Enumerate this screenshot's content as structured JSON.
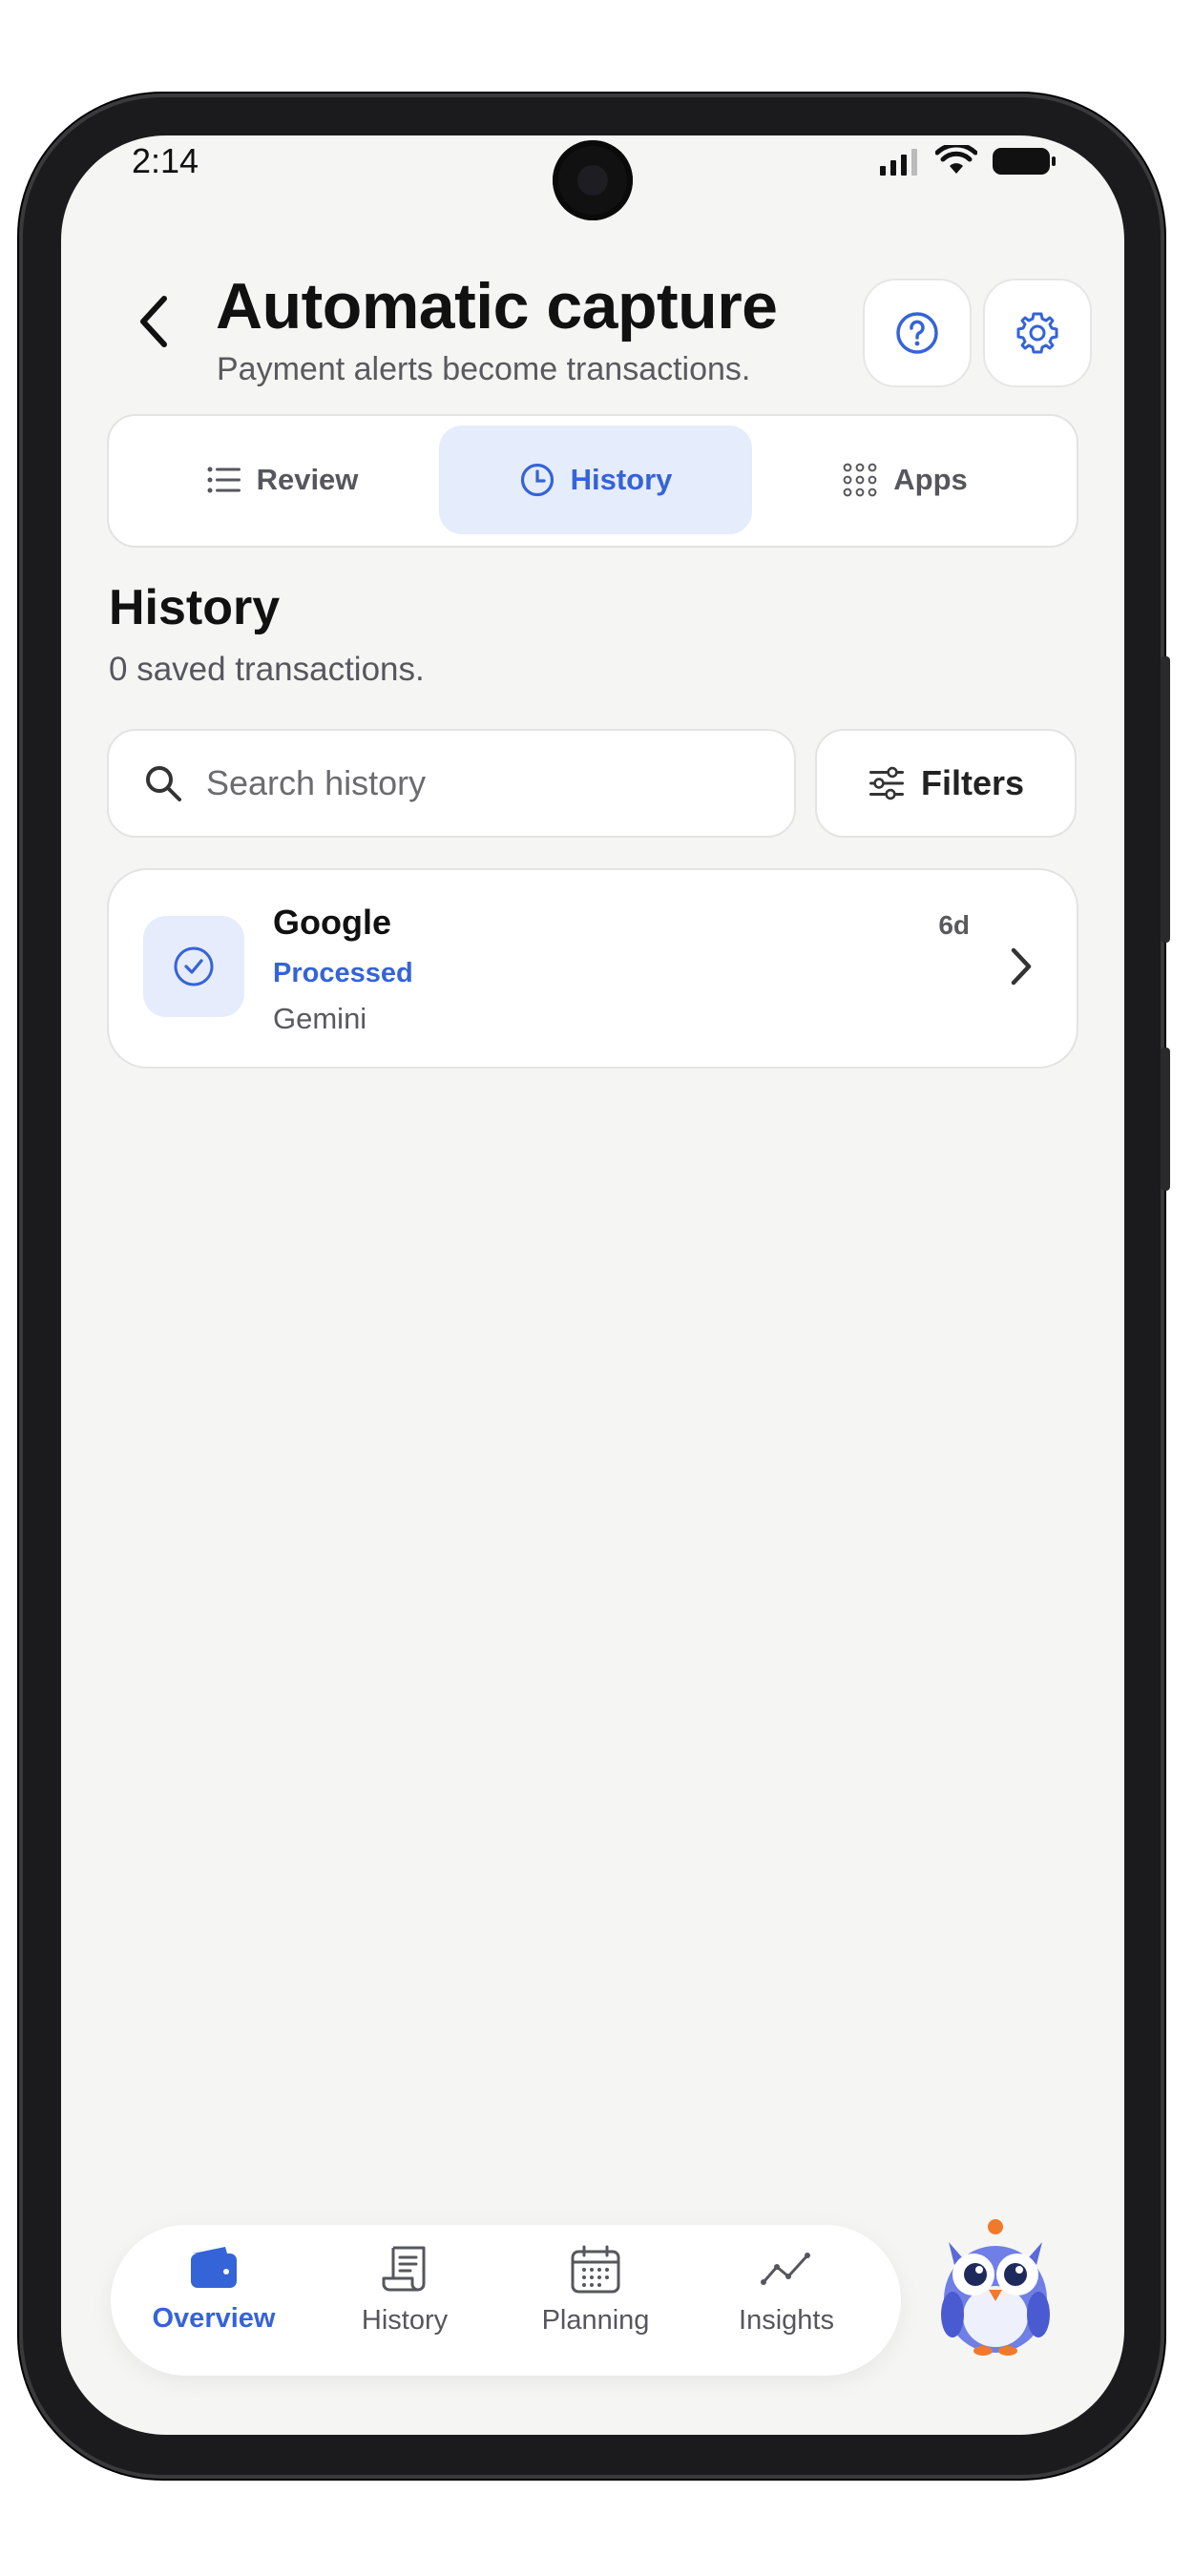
{
  "status_bar": {
    "time": "2:14"
  },
  "header": {
    "title": "Automatic capture",
    "subtitle": "Payment alerts become transactions.",
    "back_icon": "chevron-left-icon",
    "help_icon": "question-circle-icon",
    "settings_icon": "gear-icon"
  },
  "tabs": [
    {
      "label": "Review",
      "icon": "list-icon",
      "active": false
    },
    {
      "label": "History",
      "icon": "clock-icon",
      "active": true
    },
    {
      "label": "Apps",
      "icon": "grid-icon",
      "active": false
    }
  ],
  "section": {
    "title": "History",
    "subtitle": "0 saved transactions."
  },
  "search": {
    "placeholder": "Search history",
    "value": ""
  },
  "filters": {
    "label": "Filters"
  },
  "transactions": [
    {
      "merchant": "Google",
      "status": "Processed",
      "description": "Gemini",
      "age": "6d"
    }
  ],
  "bottom_nav": [
    {
      "label": "Overview",
      "icon": "wallet-icon",
      "active": true
    },
    {
      "label": "History",
      "icon": "receipt-icon",
      "active": false
    },
    {
      "label": "Planning",
      "icon": "calendar-icon",
      "active": false
    },
    {
      "label": "Insights",
      "icon": "trend-icon",
      "active": false
    }
  ],
  "colors": {
    "accent": "#3563d8",
    "accent_bg": "#e5ecfb",
    "background": "#f5f5f4",
    "card": "#ffffff"
  }
}
